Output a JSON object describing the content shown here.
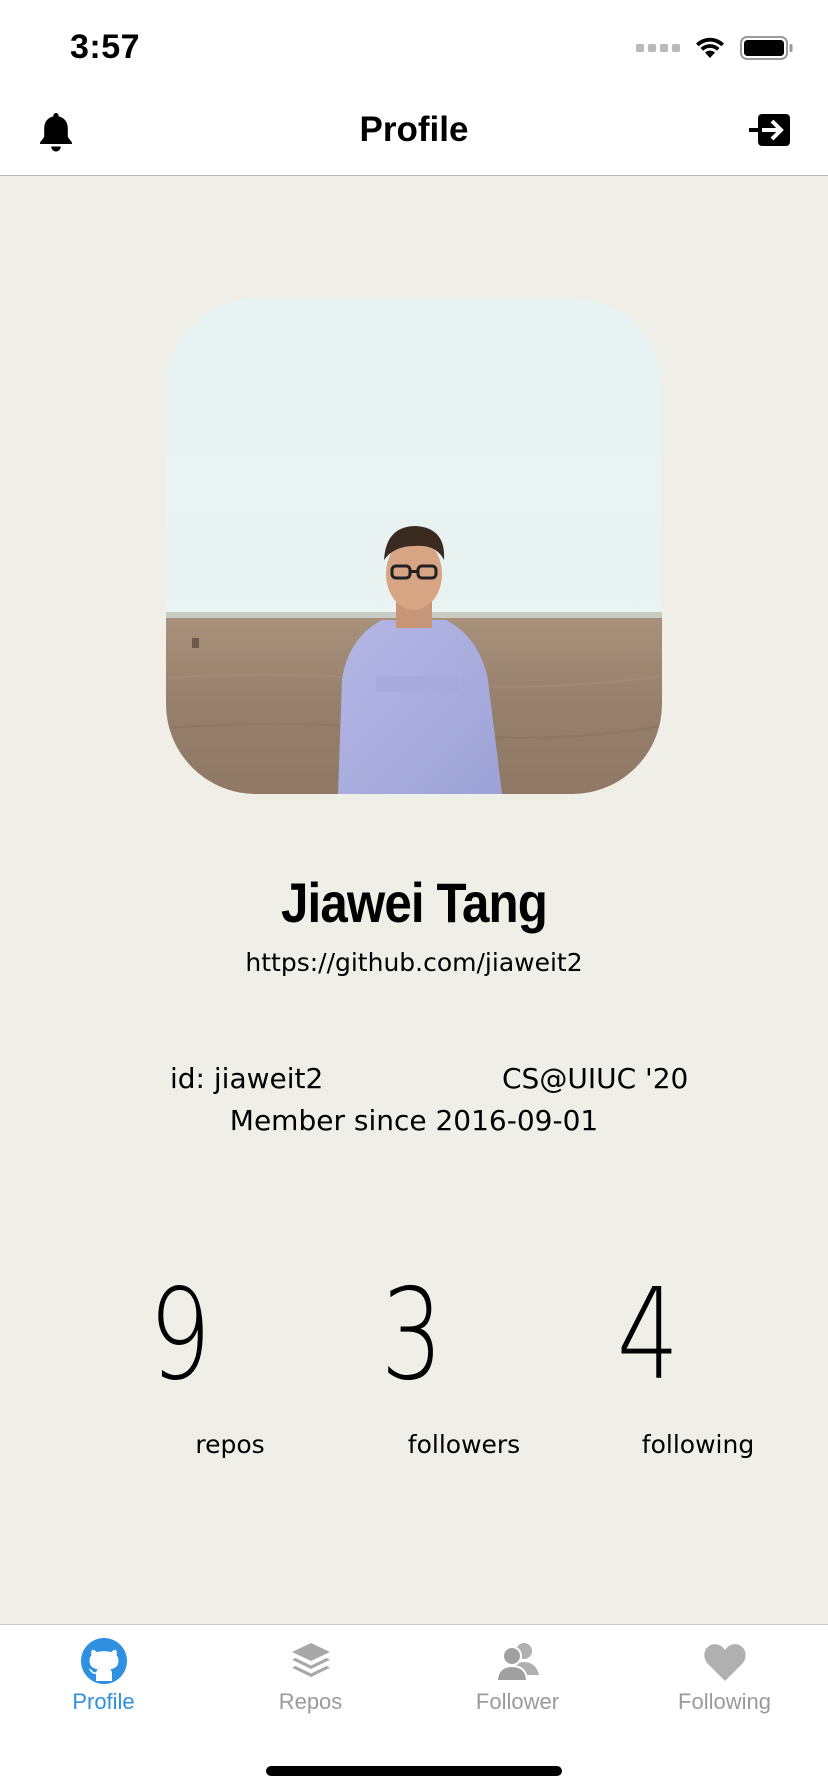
{
  "status_bar": {
    "time": "3:57"
  },
  "nav": {
    "title": "Profile",
    "left_icon": "bell-icon",
    "right_icon": "logout-icon"
  },
  "profile": {
    "name": "Jiawei Tang",
    "url": "https://github.com/jiaweit2",
    "id_text": "id: jiaweit2",
    "school": "CS@UIUC '20",
    "member_since": "Member since 2016-09-01"
  },
  "stats": {
    "repos": {
      "value": "9",
      "label": "repos"
    },
    "followers": {
      "value": "3",
      "label": "followers"
    },
    "following": {
      "value": "4",
      "label": "following"
    }
  },
  "tabs": [
    {
      "label": "Profile",
      "icon": "github-icon",
      "active": true
    },
    {
      "label": "Repos",
      "icon": "layers-icon",
      "active": false
    },
    {
      "label": "Follower",
      "icon": "users-icon",
      "active": false
    },
    {
      "label": "Following",
      "icon": "heart-icon",
      "active": false
    }
  ],
  "colors": {
    "accent": "#2f8fe0",
    "inactive": "#9a9a9a",
    "background": "#efeee7"
  }
}
